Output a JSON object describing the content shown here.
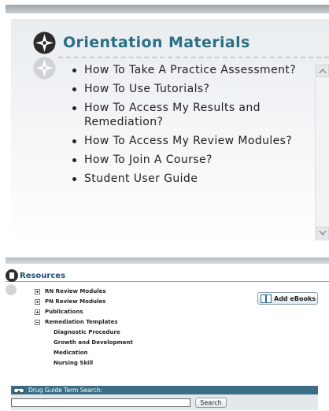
{
  "orientation": {
    "title": "Orientation Materials",
    "items": [
      "How To Take A Practice Assessment?",
      "How To Use Tutorials?",
      "How To Access My Results and Remediation?",
      "How To Access My Review Modules?",
      "How To Join A Course?",
      "Student User Guide"
    ]
  },
  "resources": {
    "title": "Resources",
    "items": [
      {
        "label": "RN Review Modules",
        "state": "collapsed"
      },
      {
        "label": "PN Review Modules",
        "state": "collapsed"
      },
      {
        "label": "Publications",
        "state": "collapsed"
      },
      {
        "label": "Remediation Templates",
        "state": "expanded"
      }
    ],
    "subitems": [
      "Diagnostic Procedure",
      "Growth and Development",
      "Medication",
      "Nursing Skill"
    ],
    "add_ebooks_label": "Add eBooks"
  },
  "drug_search": {
    "label": "Drug Guide Term Search:",
    "input_value": "",
    "button_label": "Search"
  }
}
